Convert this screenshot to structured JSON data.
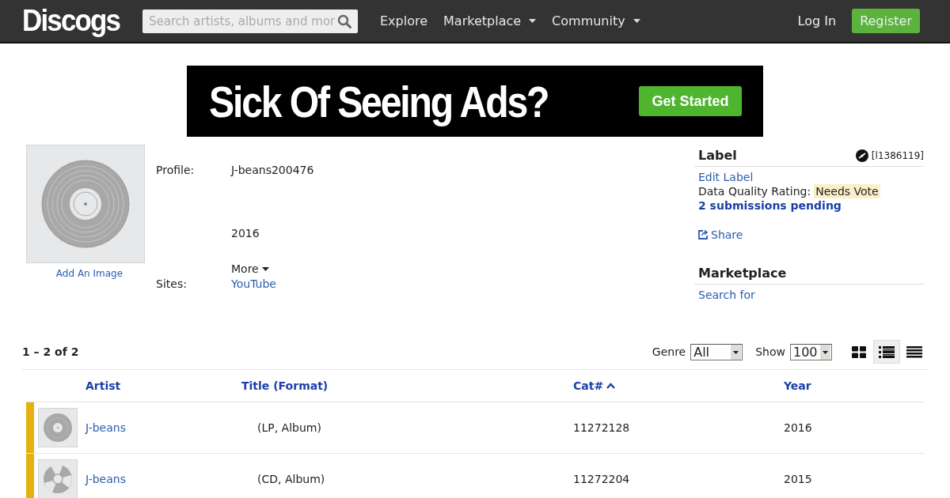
{
  "header": {
    "logo": "Discogs",
    "search": {
      "placeholder": "Search artists, albums and mor"
    },
    "nav": [
      {
        "label": "Explore",
        "dropdown": false
      },
      {
        "label": "Marketplace",
        "dropdown": true
      },
      {
        "label": "Community",
        "dropdown": true
      }
    ],
    "login": "Log In",
    "register": "Register"
  },
  "ad": {
    "headline": "Sick Of Seeing Ads?",
    "button": "Get Started"
  },
  "profile": {
    "add_image": "Add An Image",
    "profile_label": "Profile:",
    "profile_text": "J-beans200476",
    "year": "2016",
    "more": "More",
    "sites_label": "Sites:",
    "sites_link": "YouTube"
  },
  "label_box": {
    "title": "Label",
    "id": "[l1386119]",
    "edit": "Edit Label",
    "rating_label": "Data Quality Rating:",
    "rating": "Needs Vote",
    "pending": "2 submissions pending",
    "share": "Share"
  },
  "marketplace_box": {
    "title": "Marketplace",
    "link": "Search for"
  },
  "listing": {
    "count": "1 – 2 of 2",
    "genre": {
      "label": "Genre",
      "value": "All"
    },
    "show": {
      "label": "Show",
      "value": "100"
    },
    "views": [
      {
        "kind": "grid",
        "selected": false
      },
      {
        "kind": "list",
        "selected": true
      },
      {
        "kind": "text",
        "selected": false
      }
    ]
  },
  "table": {
    "columns": [
      {
        "label": "Artist",
        "sorted": false
      },
      {
        "label": "Title",
        "extra": "(Format)",
        "sorted": false
      },
      {
        "label": "Cat#",
        "sorted": true
      },
      {
        "label": "Year",
        "sorted": false
      }
    ],
    "rows": [
      {
        "kind": "vinyl",
        "color": "#e8b00f",
        "artist": "J-beans",
        "format": "(LP, Album)",
        "catno": "11272128",
        "year": "2016"
      },
      {
        "kind": "cd",
        "color": "#e8b00f",
        "artist": "J-beans",
        "format": "(CD, Album)",
        "catno": "11272204",
        "year": "2015"
      }
    ]
  }
}
